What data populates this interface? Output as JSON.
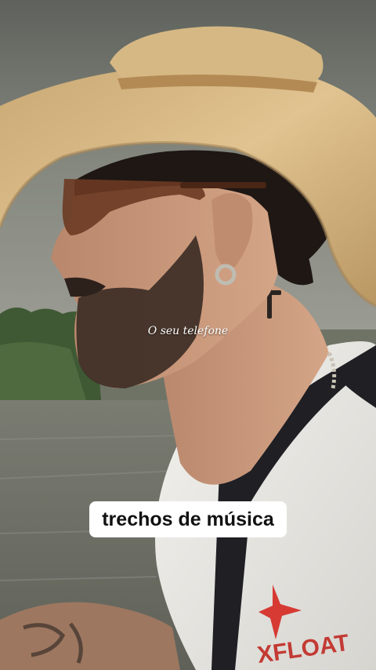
{
  "video": {
    "lyric_overlay": "O seu telefone",
    "caption": "trechos de música",
    "shirt_brand": "XFLOAT"
  },
  "colors": {
    "sky": "#7b7f77",
    "treeline": "#3e5a32",
    "water": "#77796e",
    "hat": "#d8b887",
    "skin": "#c89679",
    "beard": "#3a2b24",
    "shirt": "#ecebe8",
    "vest_accent": "#d63a33"
  }
}
